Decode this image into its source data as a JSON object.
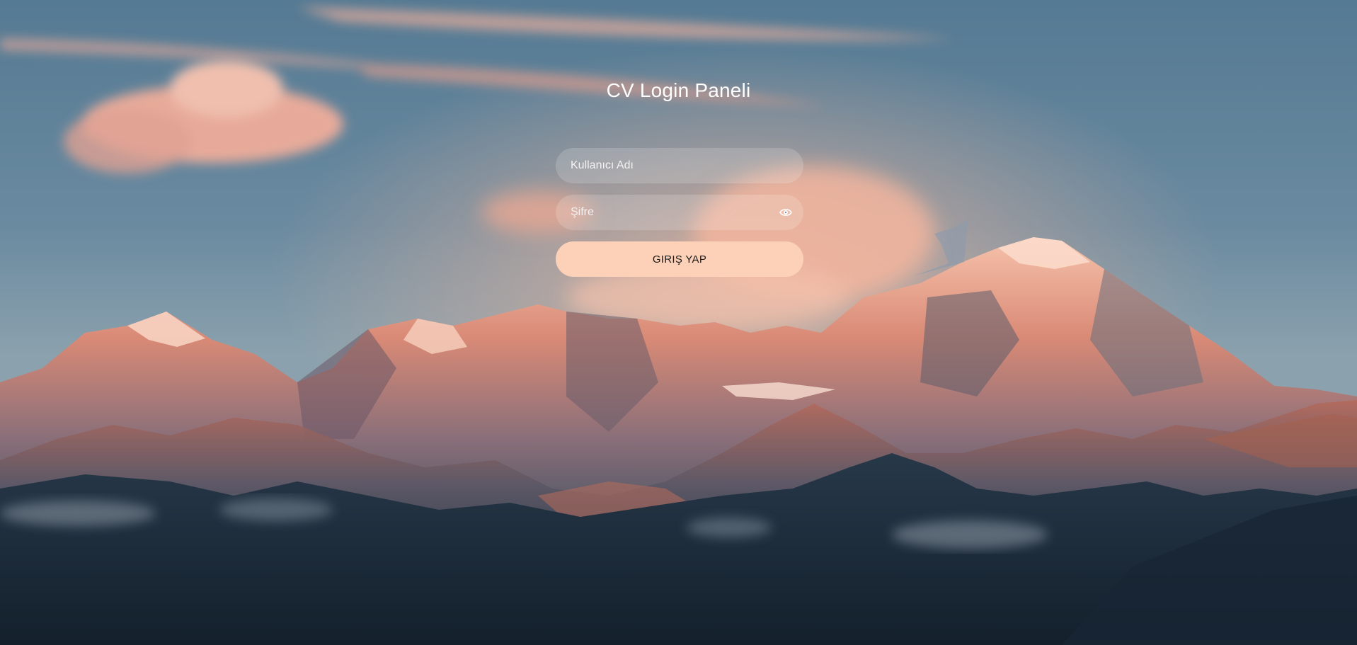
{
  "page": {
    "title": "CV Login Paneli"
  },
  "form": {
    "username_placeholder": "Kullanıcı Adı",
    "username_value": "",
    "password_placeholder": "Şifre",
    "password_value": "",
    "password_toggle_icon": "eye-icon",
    "submit_label": "GIRIŞ YAP"
  },
  "colors": {
    "button_background": "#fdd0b8",
    "button_text": "#1a1a1a",
    "field_background": "rgba(255,255,255,0.17)",
    "title_text": "#ffffff"
  }
}
